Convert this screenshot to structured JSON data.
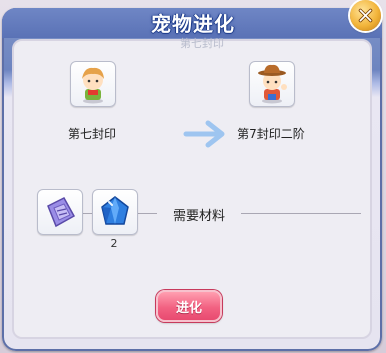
{
  "window": {
    "title": "宠物进化",
    "subtitle_behind": "第七封印"
  },
  "evolution": {
    "from": {
      "name": "第七封印",
      "icon": "blonde-boy-avatar"
    },
    "to": {
      "name": "第7封印二阶",
      "icon": "cowboy-boy-avatar"
    },
    "arrow_icon": "right-arrow-icon"
  },
  "materials": {
    "section_label": "需要材料",
    "items": [
      {
        "icon": "purple-scroll-icon",
        "count": ""
      },
      {
        "icon": "blue-crystal-icon",
        "count": "2"
      }
    ]
  },
  "actions": {
    "evolve_label": "进化",
    "close_icon": "close-icon"
  },
  "colors": {
    "title_bar": "#5a72b6",
    "evolve_button": "#f26282",
    "close_button": "#f2b43a",
    "arrow": "#9ec5f0"
  }
}
